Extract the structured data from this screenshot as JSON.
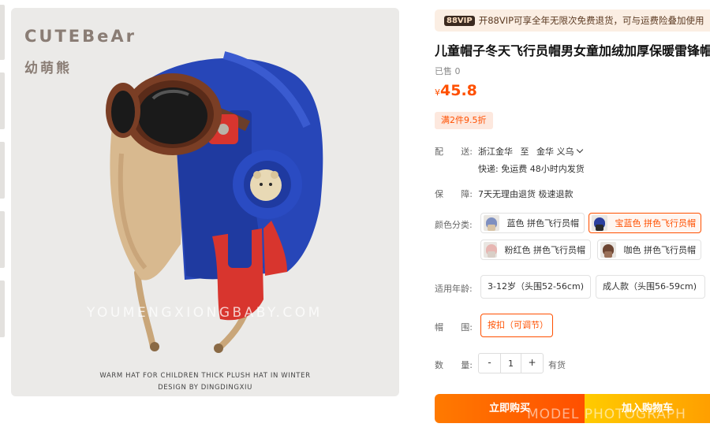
{
  "product_image": {
    "brand": "CUTEBeAr",
    "brand_cn": "幼萌熊",
    "watermark": "YOUMENGXIONGBABY.COM",
    "caption_line1": "WARM HAT FOR CHILDREN THICK PLUSH HAT IN WINTER",
    "caption_line2": "DESIGN BY DINGDINGXIU"
  },
  "vip": {
    "badge": "88VIP",
    "text": "开88VIP可享全年无限次免费退货，可与运费险叠加使用"
  },
  "product": {
    "title": "儿童帽子冬天飞行员帽男女童加绒加厚保暖雷锋帽",
    "sold": "已售 0",
    "price_symbol": "¥",
    "price": "45.8",
    "promo": "满2件9.5折"
  },
  "shipping": {
    "label_chars": [
      "配",
      "送:"
    ],
    "from": "浙江金华",
    "to_word": "至",
    "to": "金华 义乌",
    "detail": "快递: 免运费   48小时内发货"
  },
  "guarantee": {
    "label_chars": [
      "保",
      "障:"
    ],
    "text": "7天无理由退货 极速退款"
  },
  "color": {
    "label": "颜色分类:",
    "options": [
      {
        "label": "蓝色 拼色飞行员帽",
        "selected": false,
        "hat": "#7e8fc0",
        "body": "#d8c3a6"
      },
      {
        "label": "宝蓝色 拼色飞行员帽",
        "selected": true,
        "hat": "#2b3f9e",
        "body": "#2b2b2b"
      },
      {
        "label": "粉红色 拼色飞行员帽",
        "selected": false,
        "hat": "#e7b6b2",
        "body": "#d9cfc7"
      },
      {
        "label": "咖色 拼色飞行员帽",
        "selected": false,
        "hat": "#6d4532",
        "body": "#9a7058"
      }
    ]
  },
  "age": {
    "label": "适用年龄:",
    "options": [
      {
        "label": "3-12岁（头围52-56cm)",
        "selected": false
      },
      {
        "label": "成人款（头围56-59cm)",
        "selected": false
      }
    ]
  },
  "head": {
    "label_chars": [
      "帽",
      "围:"
    ],
    "option": "按扣（可调节）"
  },
  "quantity": {
    "label_chars": [
      "数",
      "量:"
    ],
    "minus": "-",
    "value": "1",
    "plus": "+",
    "stock": "有货"
  },
  "actions": {
    "buy_now": "立即购买",
    "add_cart": "加入购物车",
    "overlay_watermark": "MODEL PHOTOGRAPH"
  },
  "colors": {
    "accent": "#ff5000",
    "vip_bg": "#fbeee3"
  }
}
